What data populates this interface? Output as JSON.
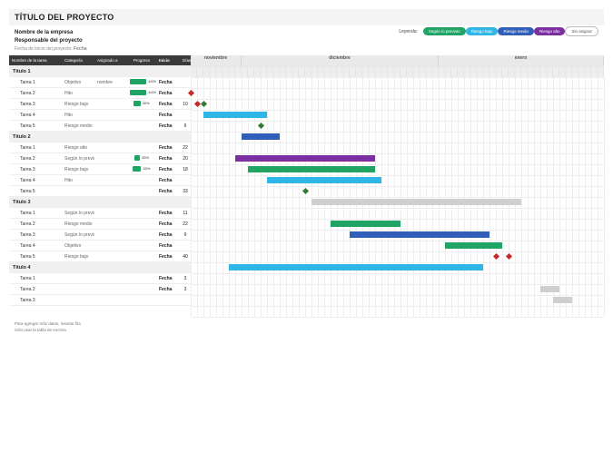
{
  "title": "TÍTULO DEL PROYECTO",
  "meta": {
    "company": "Nombre de la empresa",
    "manager": "Responsable del proyecto",
    "start_label": "Fecha de inicio del proyecto:",
    "start_value": "Fecha"
  },
  "legend": {
    "label": "Leyenda:",
    "items": [
      {
        "label": "Según lo previsto",
        "cls": "c-green"
      },
      {
        "label": "Riesgo bajo",
        "cls": "c-blue"
      },
      {
        "label": "Riesgo medio",
        "cls": "c-dblue"
      },
      {
        "label": "Riesgo alto",
        "cls": "c-purple"
      },
      {
        "label": "Sin asignar",
        "cls": "outline"
      }
    ]
  },
  "columns": [
    "Nombre de la tarea",
    "Categoría",
    "Asignado a",
    "Progreso",
    "Inicio",
    "Días"
  ],
  "months": [
    {
      "name": "noviembre",
      "days": 8
    },
    {
      "name": "diciembre",
      "days": 31
    },
    {
      "name": "enero",
      "days": 26
    }
  ],
  "total_days": 65,
  "rows": [
    {
      "type": "phase",
      "label": "Título 1"
    },
    {
      "type": "task",
      "label": "Tarea 1",
      "cat": "Objetivo",
      "assign": "nombre",
      "prog": 100,
      "start": "Fecha",
      "days": ""
    },
    {
      "type": "task",
      "label": "Tarea 2",
      "cat": "Hito",
      "assign": "",
      "prog": 100,
      "start": "Fecha",
      "days": ""
    },
    {
      "type": "task",
      "label": "Tarea 3",
      "cat": "Riesgo bajo",
      "assign": "",
      "prog": 40,
      "start": "Fecha",
      "days": 10
    },
    {
      "type": "task",
      "label": "Tarea 4",
      "cat": "Hito",
      "assign": "",
      "prog": null,
      "start": "Fecha",
      "days": ""
    },
    {
      "type": "task",
      "label": "Tarea 5",
      "cat": "Riesgo medio",
      "assign": "",
      "prog": null,
      "start": "Fecha",
      "days": 6
    },
    {
      "type": "phase",
      "label": "Título 2"
    },
    {
      "type": "task",
      "label": "Tarea 1",
      "cat": "Riesgo alto",
      "assign": "",
      "prog": null,
      "start": "Fecha",
      "days": 22
    },
    {
      "type": "task",
      "label": "Tarea 2",
      "cat": "Según lo previsto",
      "assign": "",
      "prog": 35,
      "start": "Fecha",
      "days": 20
    },
    {
      "type": "task",
      "label": "Tarea 3",
      "cat": "Riesgo bajo",
      "assign": "",
      "prog": 50,
      "start": "Fecha",
      "days": 18
    },
    {
      "type": "task",
      "label": "Tarea 4",
      "cat": "Hito",
      "assign": "",
      "prog": null,
      "start": "Fecha",
      "days": ""
    },
    {
      "type": "task",
      "label": "Tarea 5",
      "cat": "",
      "assign": "",
      "prog": null,
      "start": "Fecha",
      "days": 33
    },
    {
      "type": "phase",
      "label": "Título 3"
    },
    {
      "type": "task",
      "label": "Tarea 1",
      "cat": "Según lo previsto",
      "assign": "",
      "prog": null,
      "start": "Fecha",
      "days": 11
    },
    {
      "type": "task",
      "label": "Tarea 2",
      "cat": "Riesgo medio",
      "assign": "",
      "prog": null,
      "start": "Fecha",
      "days": 22
    },
    {
      "type": "task",
      "label": "Tarea 3",
      "cat": "Según lo previsto",
      "assign": "",
      "prog": null,
      "start": "Fecha",
      "days": 9
    },
    {
      "type": "task",
      "label": "Tarea 4",
      "cat": "Objetivo",
      "assign": "",
      "prog": null,
      "start": "Fecha",
      "days": ""
    },
    {
      "type": "task",
      "label": "Tarea 5",
      "cat": "Riesgo bajo",
      "assign": "",
      "prog": null,
      "start": "Fecha",
      "days": 40
    },
    {
      "type": "phase",
      "label": "Título 4"
    },
    {
      "type": "task",
      "label": "Tarea 1",
      "cat": "",
      "assign": "",
      "prog": null,
      "start": "Fecha",
      "days": 3
    },
    {
      "type": "task",
      "label": "Tarea 2",
      "cat": "",
      "assign": "",
      "prog": null,
      "start": "Fecha",
      "days": 3
    },
    {
      "type": "task",
      "label": "Tarea 3",
      "cat": "",
      "assign": "",
      "prog": null,
      "start": "",
      "days": ""
    }
  ],
  "footnotes": [
    "Para agregar más datos, insertar fila",
    "Sólo usar la tabla de encima"
  ],
  "chart_data": {
    "type": "gantt",
    "x_unit": "day_index",
    "x_range": [
      0,
      65
    ],
    "row_height_index": "matches rows[] including phase rows",
    "bars": [
      {
        "row": 3,
        "start": 2,
        "len": 10,
        "color": "#2fb6e6"
      },
      {
        "row": 5,
        "start": 8,
        "len": 6,
        "color": "#2f5fb8"
      },
      {
        "row": 7,
        "start": 7,
        "len": 22,
        "color": "#7b2fa0"
      },
      {
        "row": 8,
        "start": 9,
        "len": 20,
        "color": "#1fa463"
      },
      {
        "row": 9,
        "start": 12,
        "len": 18,
        "color": "#2fb6e6"
      },
      {
        "row": 11,
        "start": 19,
        "len": 33,
        "color": "#cfcfcf"
      },
      {
        "row": 13,
        "start": 22,
        "len": 11,
        "color": "#1fa463"
      },
      {
        "row": 14,
        "start": 25,
        "len": 22,
        "color": "#2f5fb8"
      },
      {
        "row": 15,
        "start": 40,
        "len": 9,
        "color": "#1fa463"
      },
      {
        "row": 17,
        "start": 6,
        "len": 40,
        "color": "#2fb6e6"
      },
      {
        "row": 19,
        "start": 55,
        "len": 3,
        "color": "#cfcfcf"
      },
      {
        "row": 20,
        "start": 57,
        "len": 3,
        "color": "#cfcfcf"
      }
    ],
    "milestones": [
      {
        "row": 1,
        "day": 0,
        "color": "#c62828"
      },
      {
        "row": 2,
        "day": 1,
        "color": "#c62828"
      },
      {
        "row": 2,
        "day": 2,
        "color": "#2e7d32"
      },
      {
        "row": 4,
        "day": 11,
        "color": "#2e7d32"
      },
      {
        "row": 10,
        "day": 18,
        "color": "#2e7d32"
      },
      {
        "row": 16,
        "day": 48,
        "color": "#c62828"
      },
      {
        "row": 16,
        "day": 50,
        "color": "#c62828"
      }
    ]
  }
}
